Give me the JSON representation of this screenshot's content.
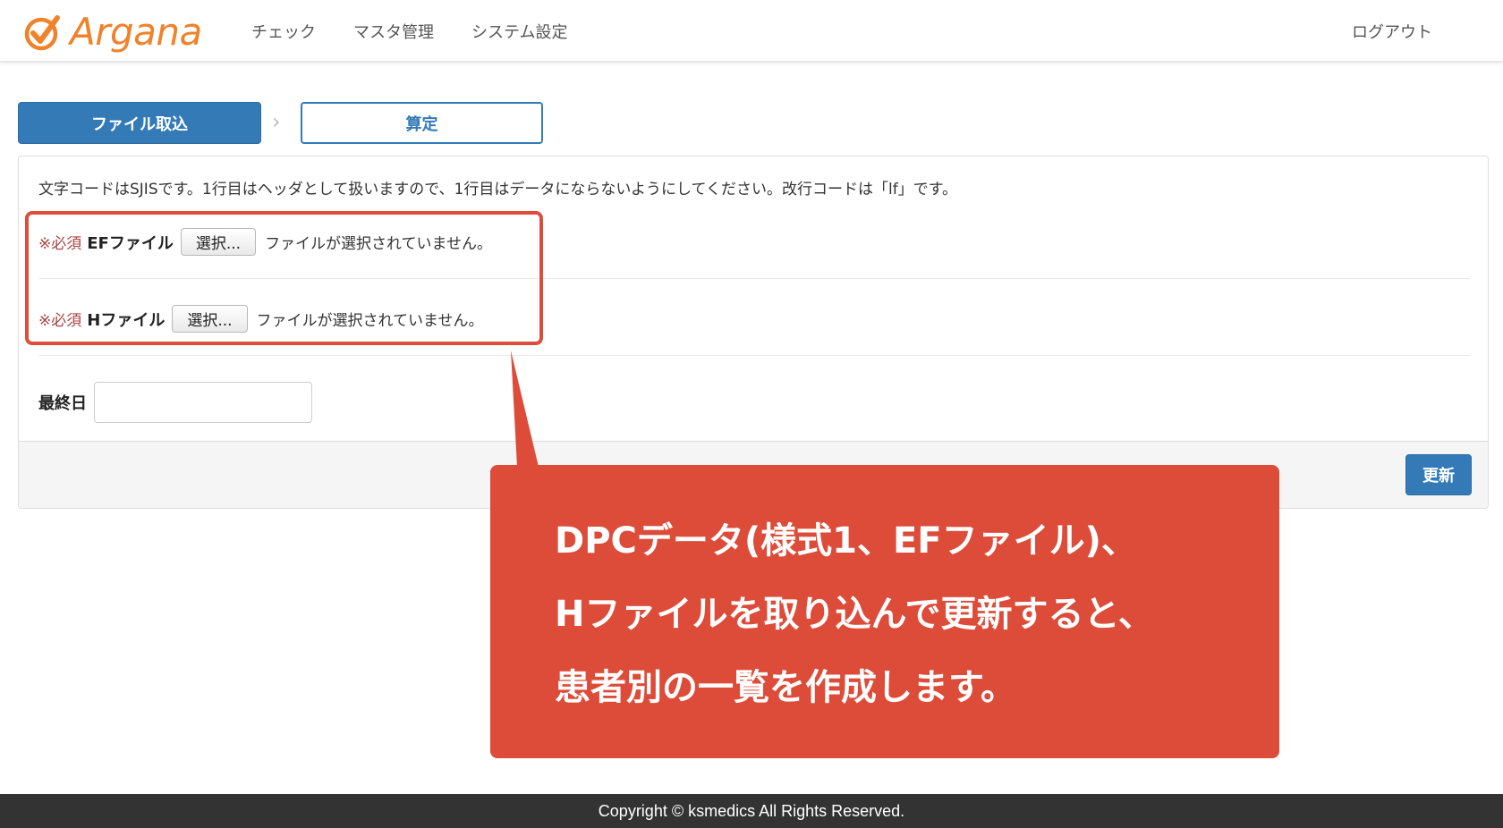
{
  "header": {
    "brand": "Argana",
    "brand_color": "#f0822a",
    "nav": [
      "チェック",
      "マスタ管理",
      "システム設定"
    ],
    "logout": "ログアウト"
  },
  "steps": {
    "active": "ファイル取込",
    "next": "算定"
  },
  "form": {
    "notice": "文字コードはSJISです。1行目はヘッダとして扱いますので、1行目はデータにならないようにしてください。改行コードは「lf」です。",
    "ef": {
      "required": "※必須",
      "label": "EFファイル",
      "button": "選択...",
      "status": "ファイルが選択されていません。"
    },
    "h": {
      "required": "※必須",
      "label": "Hファイル",
      "button": "選択...",
      "status": "ファイルが選択されていません。"
    },
    "date": {
      "label": "最終日",
      "value": ""
    },
    "submit": "更新"
  },
  "callout": {
    "lines": [
      "DPCデータ(様式1、EFファイル)、",
      "Hファイルを取り込んで更新すると、",
      "患者別の一覧を作成します。"
    ],
    "color": "#dd4b39"
  },
  "footer": {
    "copyright": "Copyright © ksmedics All Rights Reserved."
  },
  "colors": {
    "primary": "#337ab7",
    "required": "#a94442",
    "footer_bg": "#333333"
  }
}
